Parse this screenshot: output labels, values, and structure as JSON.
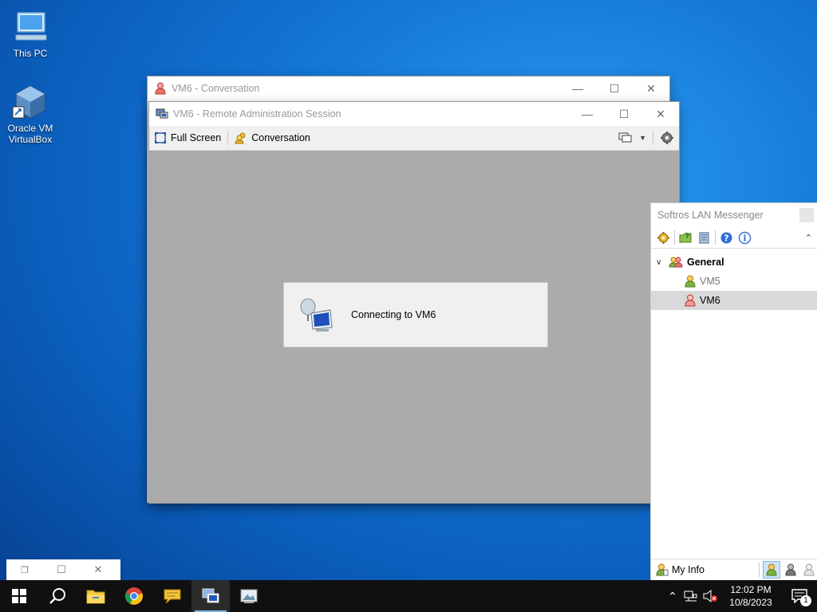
{
  "desktop": {
    "icons": [
      {
        "label": "This PC",
        "icon": "computer-icon"
      },
      {
        "label_line1": "Oracle VM",
        "label_line2": "VirtualBox",
        "icon": "virtualbox-icon"
      }
    ]
  },
  "conversation_window": {
    "title": "VM6 - Conversation",
    "icon": "user-red-icon"
  },
  "remote_window": {
    "title": "VM6 - Remote Administration Session",
    "toolbar": {
      "full_screen_label": "Full Screen",
      "conversation_label": "Conversation"
    },
    "status_text": "Connecting to VM6",
    "canvas_color": "#ababab"
  },
  "messenger": {
    "title": "Softros LAN Messenger",
    "groups": [
      {
        "name": "General",
        "users": [
          {
            "name": "VM5",
            "status": "online",
            "selected": false
          },
          {
            "name": "VM6",
            "status": "away",
            "selected": true
          }
        ]
      }
    ],
    "footer": {
      "my_info_label": "My Info"
    }
  },
  "taskbar": {
    "pinned": [
      "windows-start-icon",
      "search-icon",
      "file-explorer-icon",
      "chrome-icon",
      "messenger-icon",
      "remote-admin-icon",
      "picture-viewer-icon"
    ],
    "time": "12:02 PM",
    "date": "10/8/2023",
    "notification_count": "1"
  },
  "colors": {
    "accent": "#0078d7",
    "selection": "#d9d9d9",
    "taskbar_bg": "#101010"
  }
}
